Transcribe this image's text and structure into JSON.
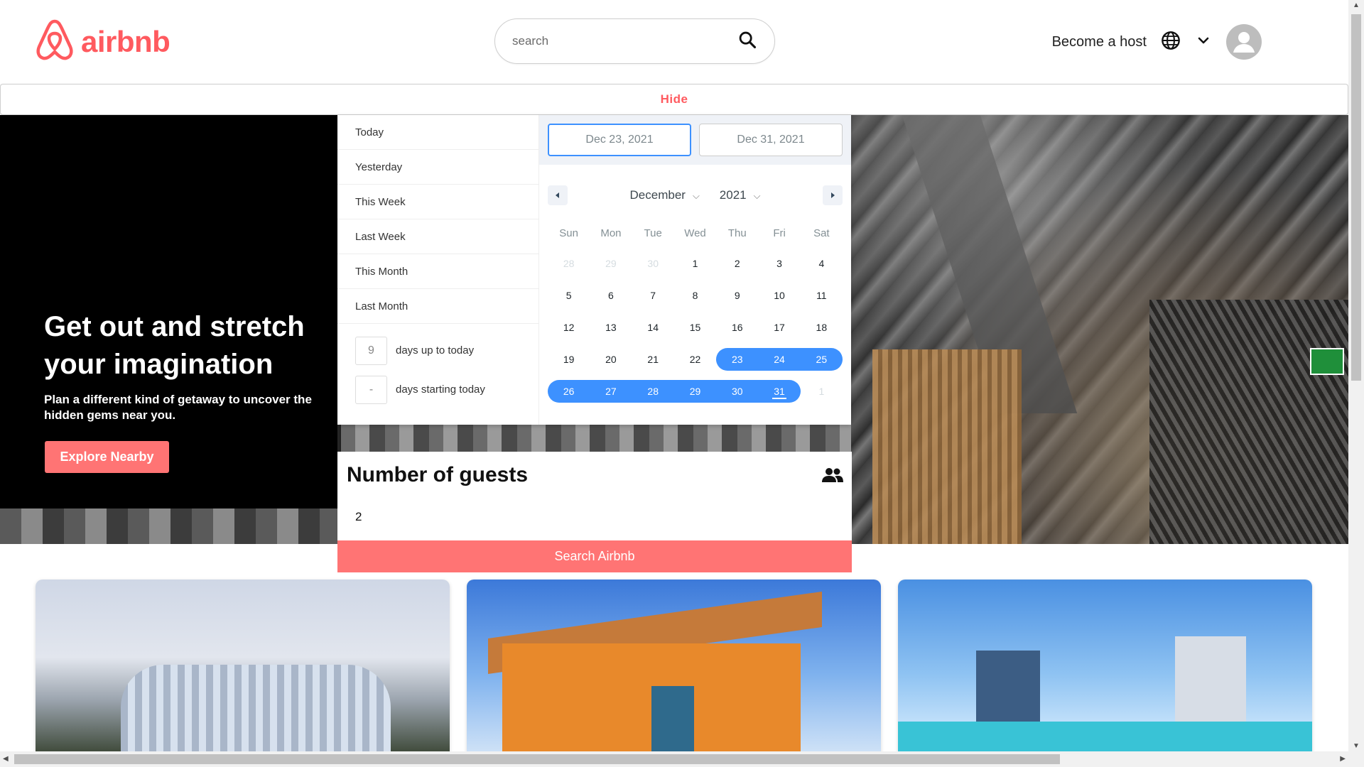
{
  "header": {
    "brand": "airbnb",
    "search_placeholder": "search",
    "become_host": "Become a host"
  },
  "hide_bar": {
    "label": "Hide"
  },
  "hero": {
    "title": "Get out and stretch your imagination",
    "subtitle": "Plan a different kind of getaway to uncover the hidden gems near you.",
    "cta": "Explore Nearby"
  },
  "date_picker": {
    "ranges": [
      "Today",
      "Yesterday",
      "This Week",
      "Last Week",
      "This Month",
      "Last Month"
    ],
    "days_up_value": "9",
    "days_up_label": "days up to today",
    "days_start_value": "-",
    "days_start_label": "days starting today",
    "start_date": "Dec 23, 2021",
    "end_date": "Dec 31, 2021",
    "month": "December",
    "year": "2021",
    "weekdays": [
      "Sun",
      "Mon",
      "Tue",
      "Wed",
      "Thu",
      "Fri",
      "Sat"
    ],
    "days": [
      {
        "d": "28",
        "s": "passive"
      },
      {
        "d": "29",
        "s": "passive"
      },
      {
        "d": "30",
        "s": "passive"
      },
      {
        "d": "1",
        "s": ""
      },
      {
        "d": "2",
        "s": ""
      },
      {
        "d": "3",
        "s": ""
      },
      {
        "d": "4",
        "s": ""
      },
      {
        "d": "5",
        "s": ""
      },
      {
        "d": "6",
        "s": ""
      },
      {
        "d": "7",
        "s": ""
      },
      {
        "d": "8",
        "s": ""
      },
      {
        "d": "9",
        "s": ""
      },
      {
        "d": "10",
        "s": ""
      },
      {
        "d": "11",
        "s": ""
      },
      {
        "d": "12",
        "s": ""
      },
      {
        "d": "13",
        "s": ""
      },
      {
        "d": "14",
        "s": ""
      },
      {
        "d": "15",
        "s": ""
      },
      {
        "d": "16",
        "s": ""
      },
      {
        "d": "17",
        "s": ""
      },
      {
        "d": "18",
        "s": ""
      },
      {
        "d": "19",
        "s": ""
      },
      {
        "d": "20",
        "s": ""
      },
      {
        "d": "21",
        "s": ""
      },
      {
        "d": "22",
        "s": ""
      },
      {
        "d": "23",
        "s": "inrange rstart"
      },
      {
        "d": "24",
        "s": "inrange"
      },
      {
        "d": "25",
        "s": "inrange rend"
      },
      {
        "d": "26",
        "s": "inrange rstart"
      },
      {
        "d": "27",
        "s": "inrange"
      },
      {
        "d": "28",
        "s": "inrange"
      },
      {
        "d": "29",
        "s": "inrange"
      },
      {
        "d": "30",
        "s": "inrange"
      },
      {
        "d": "31",
        "s": "inrange rend today-mark"
      },
      {
        "d": "1",
        "s": "passive"
      }
    ]
  },
  "guests": {
    "title": "Number of guests",
    "value": "2",
    "search_button": "Search Airbnb"
  },
  "colors": {
    "brand": "#ff5a5f",
    "button": "#ff7474",
    "range": "#3d91ff"
  },
  "icons": {
    "logo": "airbnb-belo-icon",
    "search": "search-icon",
    "globe": "globe-icon",
    "chevron": "chevron-down-icon",
    "avatar": "account-circle-icon",
    "guests": "people-icon"
  }
}
